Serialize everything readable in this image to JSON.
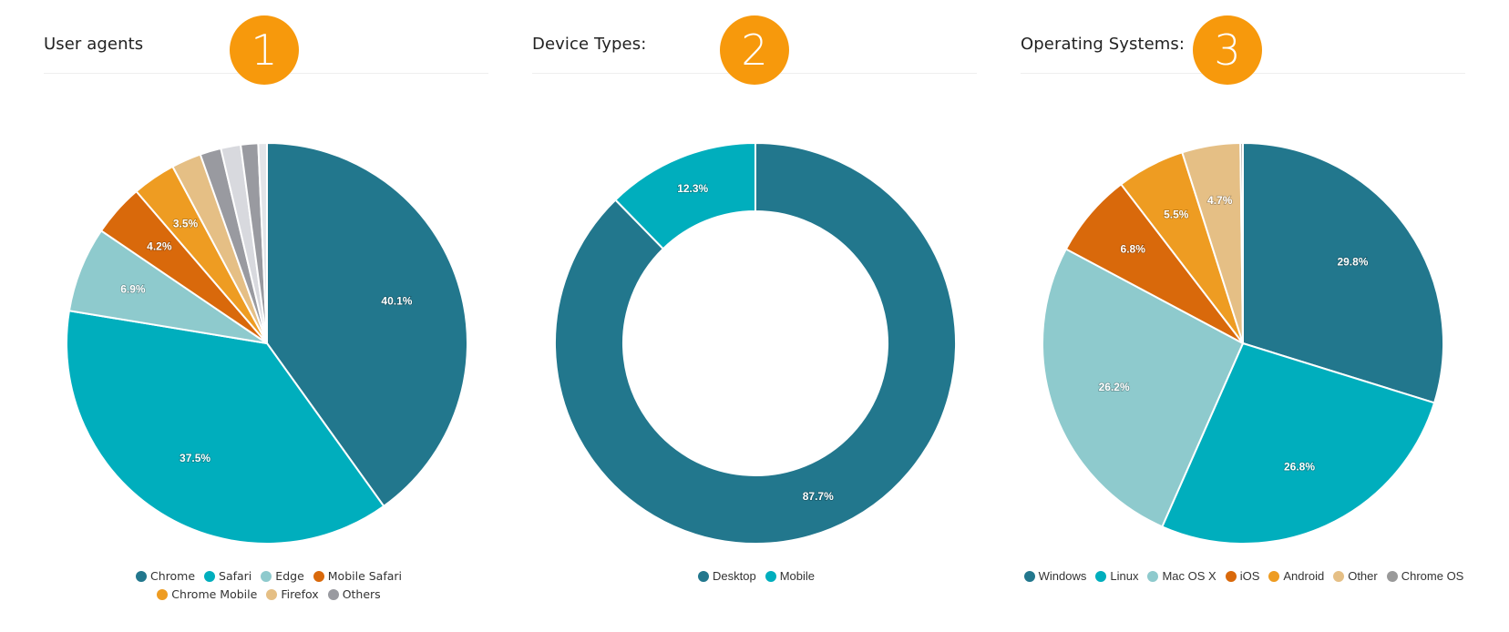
{
  "sections": [
    {
      "title": "User agents",
      "badge": "1"
    },
    {
      "title": "Device Types:",
      "badge": "2"
    },
    {
      "title": "Operating Systems:",
      "badge": "3"
    }
  ],
  "chart_data": [
    {
      "type": "pie",
      "title": "User agents",
      "categories": [
        "Chrome",
        "Safari",
        "Edge",
        "Mobile Safari",
        "Chrome Mobile",
        "Firefox",
        "Others 1",
        "Others 2",
        "Others 3",
        "Others 4"
      ],
      "values": [
        40.1,
        37.5,
        6.9,
        4.2,
        3.5,
        2.4,
        1.7,
        1.6,
        1.4,
        0.7
      ],
      "labels": [
        "40.1%",
        "37.5%",
        "6.9%",
        "4.2%",
        "3.5%",
        "",
        "",
        "",
        "",
        ""
      ],
      "colors": [
        "#22778D",
        "#00AEBD",
        "#8ECACD",
        "#D9690B",
        "#EE9C22",
        "#E5BF85",
        "#999AA0",
        "#D8D9DE",
        "#999AA0",
        "#E3E4E8"
      ],
      "legend": [
        {
          "label": "Chrome",
          "color": "#22778D"
        },
        {
          "label": "Safari",
          "color": "#00AEBD"
        },
        {
          "label": "Edge",
          "color": "#8ECACD"
        },
        {
          "label": "Mobile Safari",
          "color": "#D9690B"
        },
        {
          "label": "Chrome Mobile",
          "color": "#EE9C22"
        },
        {
          "label": "Firefox",
          "color": "#E5BF85"
        },
        {
          "label": "Others",
          "color": "#999AA0"
        }
      ],
      "legend_position": "bottom"
    },
    {
      "type": "donut",
      "title": "Device Types:",
      "categories": [
        "Desktop",
        "Mobile"
      ],
      "values": [
        87.7,
        12.3
      ],
      "labels": [
        "87.7%",
        "12.3%"
      ],
      "colors": [
        "#22778D",
        "#00AEBD"
      ],
      "legend": [
        {
          "label": "Desktop",
          "color": "#22778D"
        },
        {
          "label": "Mobile",
          "color": "#00AEBD"
        }
      ],
      "legend_position": "bottom"
    },
    {
      "type": "pie",
      "title": "Operating Systems:",
      "categories": [
        "Windows",
        "Linux",
        "Mac OS X",
        "iOS",
        "Android",
        "Other",
        "Chrome OS"
      ],
      "values": [
        29.8,
        26.8,
        26.2,
        6.8,
        5.5,
        4.7,
        0.2
      ],
      "labels": [
        "29.8%",
        "26.8%",
        "26.2%",
        "6.8%",
        "5.5%",
        "4.7%",
        ""
      ],
      "colors": [
        "#22778D",
        "#00AEBD",
        "#8ECACD",
        "#D9690B",
        "#EE9C22",
        "#E5BF85",
        "#999999"
      ],
      "legend": [
        {
          "label": "Windows",
          "color": "#22778D"
        },
        {
          "label": "Linux",
          "color": "#00AEBD"
        },
        {
          "label": "Mac OS X",
          "color": "#8ECACD"
        },
        {
          "label": "iOS",
          "color": "#D9690B"
        },
        {
          "label": "Android",
          "color": "#EE9C22"
        },
        {
          "label": "Other",
          "color": "#E5BF85"
        },
        {
          "label": "Chrome OS",
          "color": "#999999"
        }
      ],
      "legend_position": "bottom"
    }
  ]
}
